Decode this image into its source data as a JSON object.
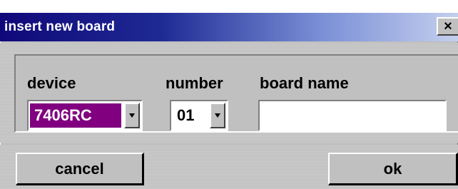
{
  "dialog": {
    "title": "insert new board",
    "close_label": "×",
    "fields": {
      "device": {
        "label": "device",
        "value": "7406RC",
        "highlight_color": "#800080"
      },
      "number": {
        "label": "number",
        "value": "01"
      },
      "board_name": {
        "label": "board name",
        "value": ""
      }
    },
    "buttons": {
      "cancel": "cancel",
      "ok": "ok"
    }
  },
  "colors": {
    "title_start": "#10087a",
    "title_end": "#c4cfee",
    "face": "#c0c0c0"
  },
  "icons": {
    "close": "close-icon",
    "dropdown": "chevron-down-icon"
  }
}
